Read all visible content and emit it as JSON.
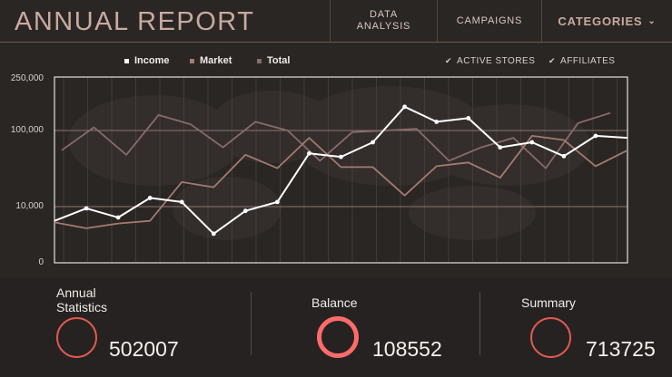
{
  "header": {
    "title": "ANNUAL REPORT",
    "nav": [
      {
        "label_line1": "DATA",
        "label_line2": "ANALYSIS"
      },
      {
        "label": "CAMPAIGNS"
      },
      {
        "label": "CATEGORIES",
        "icon": "chevron-down-icon"
      }
    ]
  },
  "legend": {
    "items": [
      {
        "label": "Income",
        "color": "#ffffff"
      },
      {
        "label": "Market",
        "color": "#a47a6e"
      },
      {
        "label": "Total",
        "color": "#8a6a6a"
      }
    ]
  },
  "filters": [
    {
      "label": "ACTIVE STORES",
      "icon": "chevron-down-icon"
    },
    {
      "label": "AFFILIATES",
      "icon": "chevron-down-icon"
    }
  ],
  "chart_data": {
    "type": "line",
    "yscale": "log",
    "yticks": [
      "250,000",
      "100,000",
      "10,000",
      "0"
    ],
    "series": [
      {
        "name": "Income",
        "color": "#ffffff",
        "values": [
          6500,
          9500,
          7200,
          13000,
          11500,
          4400,
          8800,
          11500,
          50000,
          45000,
          70000,
          205000,
          130000,
          145000,
          60000,
          70000,
          46000,
          85000,
          80000
        ]
      },
      {
        "name": "Market",
        "color": "#a47a6e",
        "values": [
          6200,
          5200,
          6000,
          6500,
          21000,
          18000,
          48000,
          32000,
          80000,
          33000,
          33000,
          14000,
          34000,
          38000,
          24000,
          85000,
          75000,
          34000,
          55000
        ]
      },
      {
        "name": "Total",
        "color": "#8a6a6a",
        "values": [
          55000,
          110000,
          48000,
          160000,
          120000,
          60000,
          130000,
          100000,
          40000,
          95000,
          100000,
          105000,
          40000,
          60000,
          80000,
          32000,
          125000,
          170000
        ]
      }
    ]
  },
  "stats": [
    {
      "label_line1": "Annual",
      "label_line2": "Statistics",
      "value": "502007",
      "ring_color": "#e05a50"
    },
    {
      "label_line1": "Balance",
      "value": "108552",
      "ring_color": "#ff6b6b"
    },
    {
      "label_line1": "Summary",
      "value": "713725",
      "ring_color": "#e05a50"
    }
  ]
}
